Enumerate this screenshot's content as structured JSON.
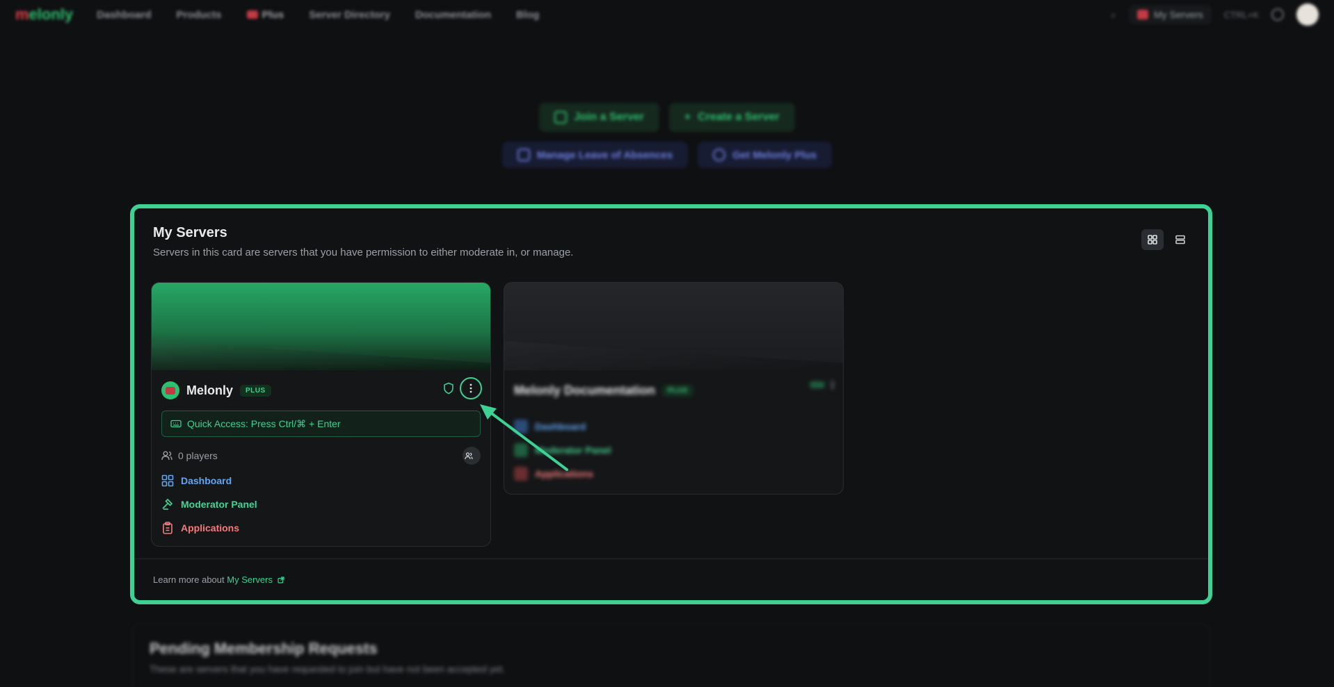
{
  "nav": {
    "logo_prefix": "m",
    "logo_rest": "elonly",
    "items": [
      "Dashboard",
      "Products",
      "Plus",
      "Server Directory",
      "Documentation",
      "Blog"
    ],
    "my_servers": "My Servers",
    "lang": "CTRL+K"
  },
  "actions": {
    "join": "Join a Server",
    "create": "Create a Server",
    "manage": "Manage Leave of Absences",
    "plus": "Get Melonly Plus"
  },
  "my_servers": {
    "title": "My Servers",
    "subtitle": "Servers in this card are servers that you have permission to either moderate in, or manage.",
    "servers": [
      {
        "name": "Melonly",
        "badge": "PLUS",
        "quick_access": "Quick Access: Press Ctrl/⌘ + Enter",
        "players": "0 players",
        "links": [
          "Dashboard",
          "Moderator Panel",
          "Applications"
        ]
      },
      {
        "name": "Melonly Documentation",
        "badge": "PLUS",
        "links": [
          "Dashboard",
          "Moderator Panel",
          "Applications"
        ]
      }
    ],
    "footer_prefix": "Learn more about",
    "footer_link": "My Servers"
  },
  "pending": {
    "title": "Pending Membership Requests",
    "subtitle": "These are servers that you have requested to join but have not been accepted yet."
  },
  "colors": {
    "accent": "#3dd193",
    "background": "#0f1012",
    "link_blue": "#62a6f4",
    "link_red": "#f47c7c"
  }
}
